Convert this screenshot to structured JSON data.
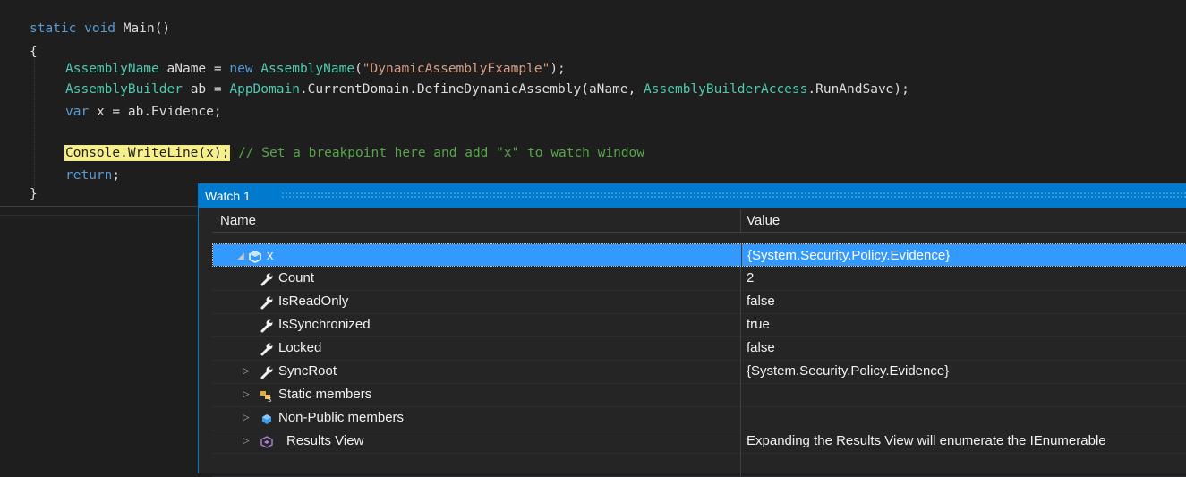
{
  "code": {
    "signature": {
      "kw": "static void",
      "name": "Main",
      "parens": "()"
    },
    "open_brace": "{",
    "line1": {
      "type": "AssemblyName",
      "var": "aName",
      "eq": "=",
      "kw_new": "new",
      "ctor": "AssemblyName",
      "paren_open": "(",
      "str": "\"DynamicAssemblyExample\"",
      "paren_close": ");"
    },
    "line2": {
      "type": "AssemblyBuilder",
      "var": "ab",
      "eq": "=",
      "cls": "AppDomain",
      "rest": ".CurrentDomain.DefineDynamicAssembly(aName, ",
      "enum": "AssemblyBuilderAccess",
      "rest2": ".RunAndSave);"
    },
    "line3": {
      "kw": "var",
      "rest": "x = ab.Evidence;"
    },
    "line4": {
      "highlight": "Console.WriteLine(x);",
      "comment": "// Set a breakpoint here and add \"x\" to watch window"
    },
    "line5": {
      "kw": "return",
      "semi": ";"
    },
    "close_brace": "}"
  },
  "watch": {
    "title": "Watch 1",
    "columns": {
      "name": "Name",
      "value": "Value"
    },
    "rows": [
      {
        "name": "x",
        "value": "{System.Security.Policy.Evidence}",
        "icon": "object-icon",
        "expander": "expanded",
        "selected": true
      },
      {
        "name": "Count",
        "value": "2",
        "icon": "wrench-icon",
        "expander": "none"
      },
      {
        "name": "IsReadOnly",
        "value": "false",
        "icon": "wrench-icon",
        "expander": "none"
      },
      {
        "name": "IsSynchronized",
        "value": "true",
        "icon": "wrench-icon",
        "expander": "none"
      },
      {
        "name": "Locked",
        "value": "false",
        "icon": "wrench-icon",
        "expander": "none"
      },
      {
        "name": "SyncRoot",
        "value": "{System.Security.Policy.Evidence}",
        "icon": "wrench-icon",
        "expander": "collapsed"
      },
      {
        "name": "Static members",
        "value": "",
        "icon": "static-members-icon",
        "expander": "collapsed"
      },
      {
        "name": "Non-Public members",
        "value": "",
        "icon": "non-public-icon",
        "expander": "collapsed"
      },
      {
        "name": "Results View",
        "value": "Expanding the Results View will enumerate the IEnumerable",
        "icon": "results-view-icon",
        "expander": "collapsed"
      }
    ]
  },
  "colors": {
    "accent": "#007acc",
    "selection": "#3399ff",
    "keyword": "#569cd6",
    "type": "#4ec9b0",
    "string": "#d69d85",
    "comment": "#57a64a",
    "breakpoint_highlight": "#f6ef8c"
  }
}
